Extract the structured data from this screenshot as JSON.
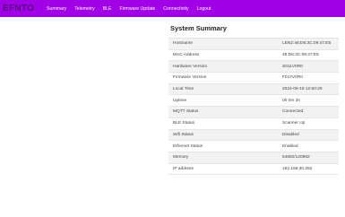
{
  "nav": {
    "logo_text": "EFNTO",
    "links": [
      {
        "label": "Summary"
      },
      {
        "label": "Telemetry"
      },
      {
        "label": "BLE"
      },
      {
        "label": "Firmware Update"
      },
      {
        "label": "Connectivity"
      },
      {
        "label": "Logout"
      }
    ]
  },
  "colors": {
    "navbar": "#a100e6",
    "row_alt": "#f2f2f2"
  },
  "summary": {
    "title": "System Summary",
    "rows": [
      {
        "label": "Hostname",
        "value": "LEN2:48:D6:3C:09:47:E5"
      },
      {
        "label": "MAC Address",
        "value": "48:D6:3C:09:47:E5"
      },
      {
        "label": "Hardware Version",
        "value": "S011V0R0"
      },
      {
        "label": "Firmware Version",
        "value": "F017V0R0"
      },
      {
        "label": "Local Time",
        "value": "2024-09-19 12:60:29"
      },
      {
        "label": "Uptime",
        "value": "0h 0m 3s"
      },
      {
        "label": "MQTT Status",
        "value": "Connected"
      },
      {
        "label": "BLE Status",
        "value": "Scanner Up"
      },
      {
        "label": "Wifi Status",
        "value": "Disabled"
      },
      {
        "label": "Ethernet Status",
        "value": "Enabled"
      },
      {
        "label": "Memory",
        "value": "54682/120982"
      },
      {
        "label": "IP address",
        "value": "192.168.30.252"
      }
    ]
  }
}
